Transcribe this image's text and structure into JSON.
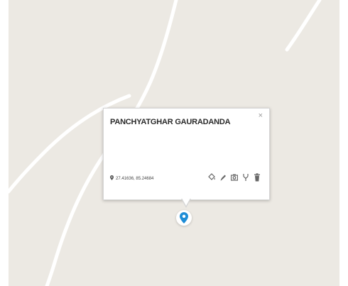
{
  "colors": {
    "map_background": "#ece9e3",
    "road": "#ffffff",
    "marker": "#1f8dd6",
    "icon": "#666666"
  },
  "popup": {
    "title": "PANCHYATGHAR GAURADANDA",
    "close_icon": "×",
    "coordinates": "27.41636, 85.24684",
    "actions": [
      {
        "icon": "paint-bucket-icon"
      },
      {
        "icon": "pencil-icon"
      },
      {
        "icon": "camera-icon"
      },
      {
        "icon": "fork-icon"
      },
      {
        "icon": "trash-icon"
      }
    ]
  },
  "marker": {
    "icon": "map-pin-icon"
  }
}
